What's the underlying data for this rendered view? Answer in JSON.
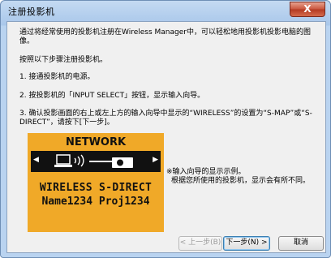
{
  "window": {
    "title": "注册投影机",
    "close_label": "X"
  },
  "content": {
    "intro": "通过将经常使用的投影机注册在Wireless Manager中，可以轻松地用投影机投影电脑的图像。",
    "steps_heading": "按照以下步骤注册投影机。",
    "step1": "1. 接通投影机的电源。",
    "step2": "2. 按投影机的「INPUT SELECT」按钮，显示输入向导。",
    "step3": "3. 确认投影画面的右上或左上方的输入向导中显示的“WIRELESS”的设置为“S-MAP”或“S-DIRECT”，请按下[下一步]。"
  },
  "guide": {
    "network_label": "NETWORK",
    "mode_label": "WIRELESS S-DIRECT",
    "names_line": "Name1234 Proj1234",
    "background_color": "#f0a928"
  },
  "note": {
    "line1": "※输入向导的显示示例。",
    "line2": "根据您所使用的投影机，显示会有所不同。"
  },
  "buttons": {
    "back": "< 上一步(B)",
    "next": "下一步(N) >",
    "cancel": "取消"
  }
}
